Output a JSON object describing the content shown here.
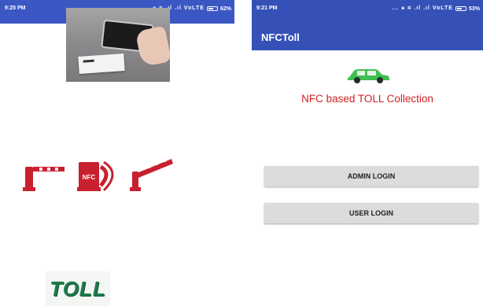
{
  "screens": {
    "splash": {
      "status": {
        "time": "9:25 PM",
        "icons": "... ⚹ ≋ .ıl .ıl VoLTE",
        "battery": "62%"
      },
      "logo_text": "TOLL",
      "icon_names": [
        "nfc-phone-photo",
        "toll-barrier-icon",
        "nfc-pump-icon",
        "toll-gate-open-icon"
      ],
      "icon_labels": {
        "nfc_badge": "NFC"
      },
      "colors": {
        "status_bar": "#3b57c4",
        "icon_red": "#c8202f",
        "logo_green": "#1d7a4a"
      }
    },
    "home": {
      "status": {
        "time": "9:21 PM",
        "icons": "... ⚹ ≋ .ıl .ıl VoLTE",
        "battery": "53%"
      },
      "app_title": "NFCToll",
      "headline": "NFC based TOLL Collection",
      "buttons": {
        "admin_login": "ADMIN LOGIN",
        "user_login": "USER LOGIN"
      },
      "icon_names": [
        "car-icon"
      ],
      "colors": {
        "app_bar": "#3551b8",
        "headline": "#d42020",
        "car": "#3fbf4f",
        "button_bg": "#dcdcdc"
      }
    }
  }
}
